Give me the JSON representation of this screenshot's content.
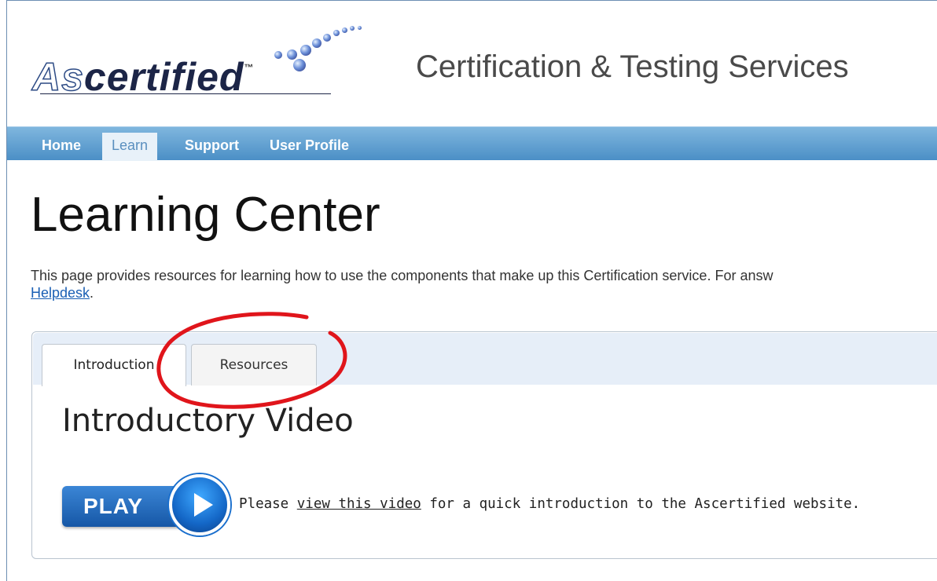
{
  "brand": {
    "logo_text_prefix": "As",
    "logo_text_suffix": "certified",
    "logo_trademark": "™",
    "site_title": "Certification & Testing Services"
  },
  "nav": {
    "items": [
      {
        "label": "Home",
        "active": false
      },
      {
        "label": "Learn",
        "active": true
      },
      {
        "label": "Support",
        "active": false
      },
      {
        "label": "User Profile",
        "active": false
      }
    ]
  },
  "page": {
    "title": "Learning Center",
    "description": "This page provides resources for learning how to use the components that make up this Certification service. For answ",
    "helpdesk_link": "Helpdesk",
    "helpdesk_suffix": "."
  },
  "tabs": {
    "items": [
      {
        "label": "Introduction",
        "active": true
      },
      {
        "label": "Resources",
        "active": false
      }
    ]
  },
  "intro": {
    "section_title": "Introductory Video",
    "play_label": "PLAY",
    "text_before": "Please ",
    "video_link": "view this video",
    "text_after": " for a quick introduction to the Ascertified website."
  },
  "colors": {
    "nav_bar": "#5f9fd2",
    "annotation": "#e0151b",
    "link": "#1a5fb4"
  }
}
